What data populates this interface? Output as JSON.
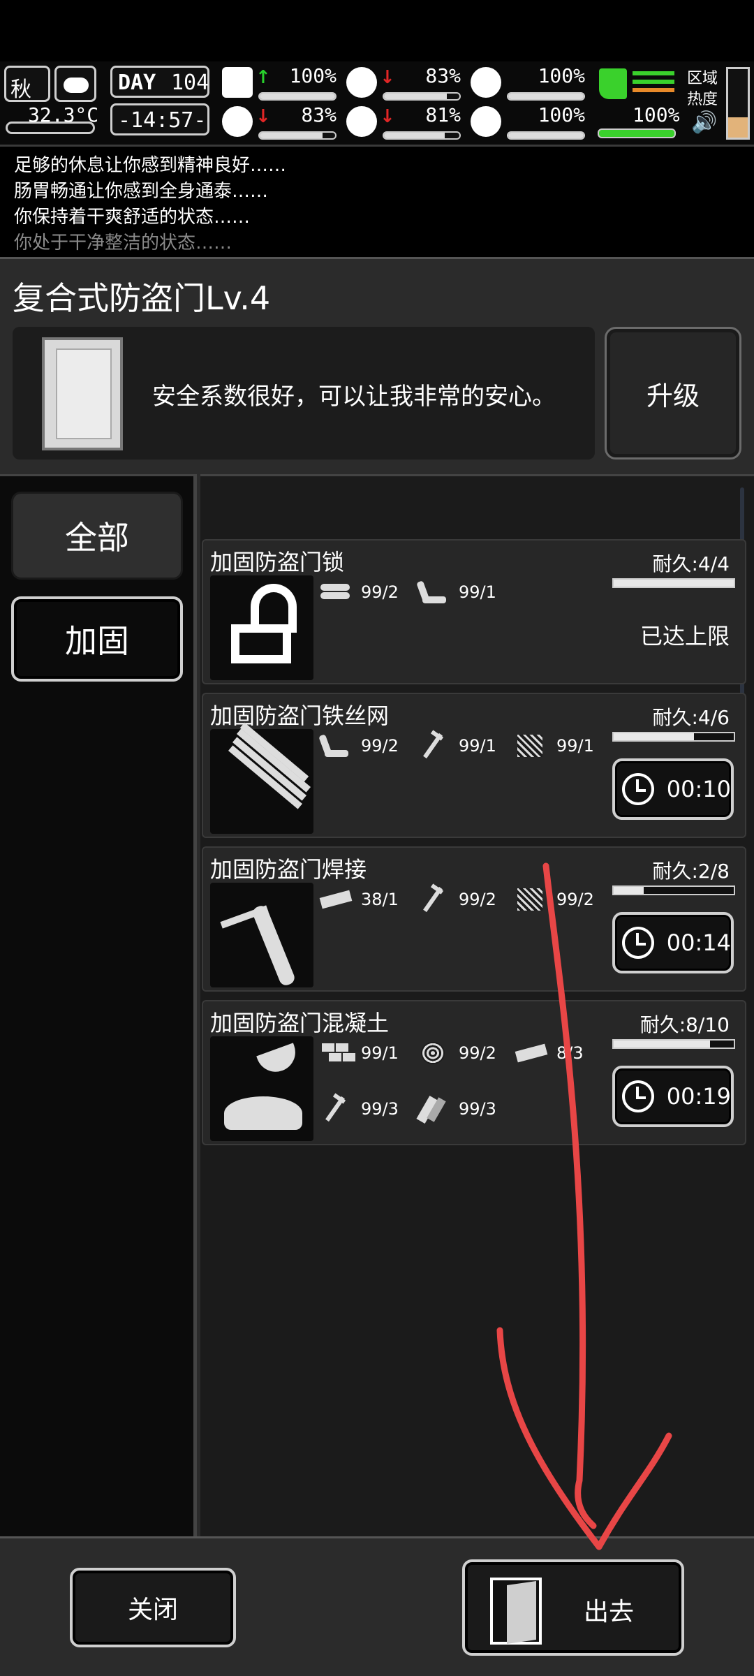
{
  "status": {
    "season": "秋",
    "temperature": "32.3°C",
    "day_label": "DAY",
    "day": "104",
    "clock": "-14:57-",
    "zone_heat_label": "区域热度",
    "stats": [
      {
        "name": "health",
        "pct": "100%",
        "trend": "up",
        "level": 1.0
      },
      {
        "name": "hunger",
        "pct": "83%",
        "trend": "down",
        "level": 0.83
      },
      {
        "name": "pill",
        "pct": "100%",
        "trend": "none",
        "level": 1.0
      },
      {
        "name": "mental",
        "pct": "83%",
        "trend": "down",
        "level": 0.83
      },
      {
        "name": "thirst",
        "pct": "81%",
        "trend": "down",
        "level": 0.81
      },
      {
        "name": "heart",
        "pct": "100%",
        "trend": "none",
        "level": 1.0
      }
    ],
    "stamina_pct": "100%",
    "colors": {
      "accent_green": "#3ad12c",
      "up": "#28d12c",
      "down": "#e22626",
      "heat": "#e2b37a"
    }
  },
  "log": [
    "足够的休息让你感到精神良好……",
    "肠胃畅通让你感到全身通泰……",
    "你保持着干爽舒适的状态……",
    "你处于干净整洁的状态……"
  ],
  "panel": {
    "title": "复合式防盗门Lv.4",
    "description": "安全系数很好，可以让我非常的安心。",
    "upgrade_label": "升级"
  },
  "tabs": {
    "all": "全部",
    "reinforce": "加固"
  },
  "items": [
    {
      "name": "加固防盗门锁",
      "icon": "unlocked-padlock-icon",
      "durability": "耐久:4/4",
      "durability_level": 1.0,
      "status": "已达上限",
      "materials": [
        {
          "icon": "wood-logs-icon",
          "count": "99/2"
        },
        {
          "icon": "pipe-icon",
          "count": "99/1"
        }
      ]
    },
    {
      "name": "加固防盗门铁丝网",
      "icon": "wire-mesh-icon",
      "durability": "耐久:4/6",
      "durability_level": 0.67,
      "timer": "00:10",
      "materials": [
        {
          "icon": "pipe-icon",
          "count": "99/2"
        },
        {
          "icon": "nail-icon",
          "count": "99/1"
        },
        {
          "icon": "mesh-icon",
          "count": "99/1"
        }
      ]
    },
    {
      "name": "加固防盗门焊接",
      "icon": "welding-torch-icon",
      "durability": "耐久:2/8",
      "durability_level": 0.25,
      "timer": "00:14",
      "materials": [
        {
          "icon": "metal-board-icon",
          "count": "38/1"
        },
        {
          "icon": "nail-icon",
          "count": "99/2"
        },
        {
          "icon": "mesh-icon",
          "count": "99/2"
        }
      ]
    },
    {
      "name": "加固防盗门混凝土",
      "icon": "trowel-cement-icon",
      "durability": "耐久:8/10",
      "durability_level": 0.8,
      "timer": "00:19",
      "materials": [
        {
          "icon": "bricks-icon",
          "count": "99/1"
        },
        {
          "icon": "straw-icon",
          "count": "99/2"
        },
        {
          "icon": "metal-board-icon",
          "count": "8/3"
        },
        {
          "icon": "nail-icon",
          "count": "99/3"
        },
        {
          "icon": "planks-icon",
          "count": "99/3"
        }
      ]
    }
  ],
  "buttons": {
    "close": "关闭",
    "exit": "出去"
  },
  "annotation": {
    "type": "hand-drawn-arrow",
    "color": "#e84646"
  }
}
